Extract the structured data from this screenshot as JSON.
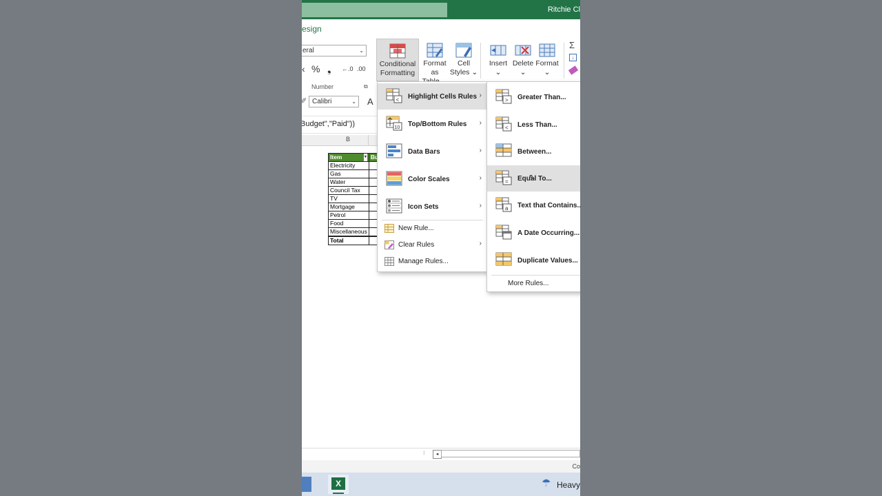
{
  "title_bar": {
    "user": "Ritchie Cl"
  },
  "ribbon": {
    "tab_design": "esign",
    "number_format_value": "eral",
    "number_symbols": [
      "%",
      "❟",
      "←.0",
      ".00"
    ],
    "group_number_label": "Number",
    "conditional_formatting": {
      "line1": "Conditional",
      "line2": "Formatting ⌄"
    },
    "format_as_table": {
      "line1": "Format as",
      "line2": "Table ⌄"
    },
    "cell_styles": {
      "line1": "Cell",
      "line2": "Styles ⌄"
    },
    "insert": {
      "label": "Insert",
      "arrow": "⌄"
    },
    "delete": {
      "label": "Delete",
      "arrow": "⌄"
    },
    "format": {
      "label": "Format",
      "arrow": "⌄"
    },
    "font_name": "Calibri",
    "font_letter": "A"
  },
  "formula_bar": {
    "text": "Budget\",\"Paid\"))"
  },
  "sheet": {
    "column_header": "B",
    "table_header": {
      "item": "Item",
      "col2": "Bu"
    },
    "rows": [
      "Electricity",
      "Gas",
      "Water",
      "Council Tax",
      "TV",
      "Mortgage",
      "Petrol",
      "Food",
      "Miscellaneous"
    ],
    "total": "Total"
  },
  "cf_menu": {
    "items": [
      {
        "label": "Highlight Cells Rules",
        "icon": "highlight-cells-icon"
      },
      {
        "label": "Top/Bottom Rules",
        "icon": "top-bottom-icon"
      },
      {
        "label": "Data Bars",
        "icon": "data-bars-icon"
      },
      {
        "label": "Color Scales",
        "icon": "color-scales-icon"
      },
      {
        "label": "Icon Sets",
        "icon": "icon-sets-icon"
      }
    ],
    "new_rule": "New Rule...",
    "clear_rules": "Clear Rules",
    "manage_rules": "Manage Rules..."
  },
  "submenu": {
    "items": [
      {
        "label": "Greater Than...",
        "symbol": ">"
      },
      {
        "label": "Less Than...",
        "symbol": "<"
      },
      {
        "label": "Between...",
        "symbol": ""
      },
      {
        "label": "Equal To...",
        "symbol": "="
      },
      {
        "label": "Text that Contains...",
        "symbol": "a"
      },
      {
        "label": "A Date Occurring...",
        "symbol": ""
      },
      {
        "label": "Duplicate Values...",
        "symbol": ""
      }
    ],
    "more_rules": "More Rules..."
  },
  "status": {
    "text": "Co"
  },
  "taskbar": {
    "weather": "Heavy"
  },
  "colors": {
    "excel_green": "#227447",
    "highlight": "#e0e0e0",
    "table_header": "#4e8a2e"
  }
}
